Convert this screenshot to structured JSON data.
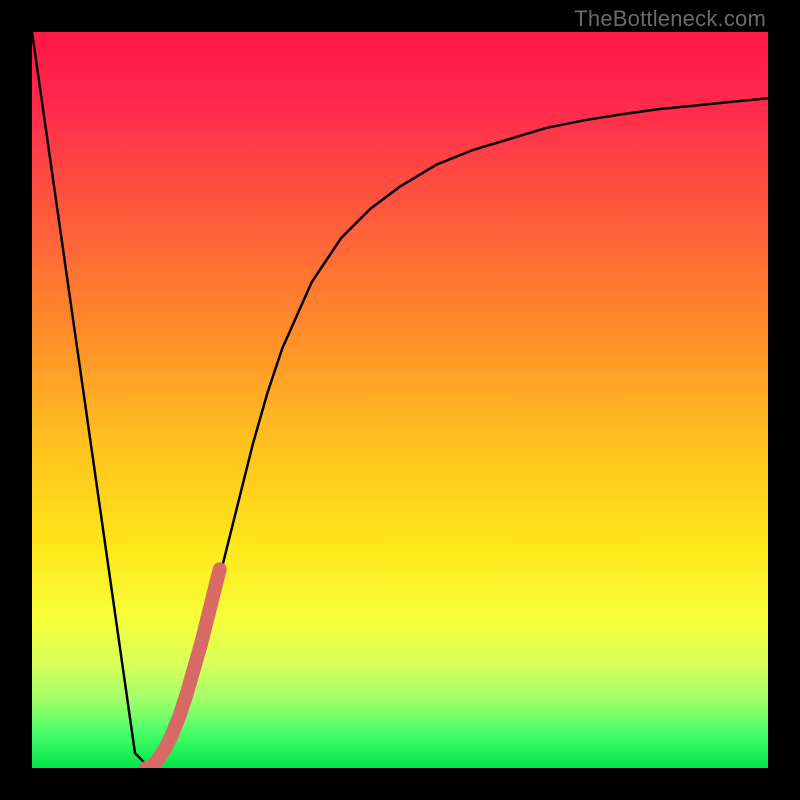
{
  "watermark": "TheBottleneck.com",
  "chart_data": {
    "type": "line",
    "title": "",
    "xlabel": "",
    "ylabel": "",
    "xlim": [
      0,
      100
    ],
    "ylim": [
      0,
      100
    ],
    "series": [
      {
        "name": "bottleneck-curve",
        "x": [
          0,
          2,
          4,
          6,
          8,
          10,
          12,
          14,
          16,
          18,
          20,
          22,
          24,
          26,
          28,
          30,
          32,
          34,
          38,
          42,
          46,
          50,
          55,
          60,
          65,
          70,
          75,
          80,
          85,
          90,
          95,
          100
        ],
        "values": [
          100,
          86,
          72,
          58,
          44,
          30,
          16,
          2,
          0,
          2,
          6,
          12,
          20,
          28,
          36,
          44,
          51,
          57,
          66,
          72,
          76,
          79,
          82,
          84,
          85.5,
          87,
          88,
          88.8,
          89.5,
          90,
          90.5,
          91
        ]
      },
      {
        "name": "highlight-segment",
        "x": [
          15.5,
          16,
          17,
          18,
          19,
          20,
          21,
          22,
          23,
          24,
          25,
          25.5
        ],
        "values": [
          0,
          0,
          1,
          2.5,
          4.5,
          7,
          10,
          13.5,
          17,
          21,
          25,
          27
        ]
      }
    ],
    "gradient_stops": [
      {
        "pos": 0,
        "color": "#ff1744"
      },
      {
        "pos": 10,
        "color": "#ff2a4d"
      },
      {
        "pos": 25,
        "color": "#ff5a3c"
      },
      {
        "pos": 40,
        "color": "#ff8a2b"
      },
      {
        "pos": 55,
        "color": "#ffbf1f"
      },
      {
        "pos": 70,
        "color": "#ffe71a"
      },
      {
        "pos": 80,
        "color": "#f6ff3a"
      },
      {
        "pos": 86,
        "color": "#d8ff5a"
      },
      {
        "pos": 91,
        "color": "#9cff6a"
      },
      {
        "pos": 95,
        "color": "#4cff6a"
      },
      {
        "pos": 100,
        "color": "#00e54a"
      }
    ]
  }
}
